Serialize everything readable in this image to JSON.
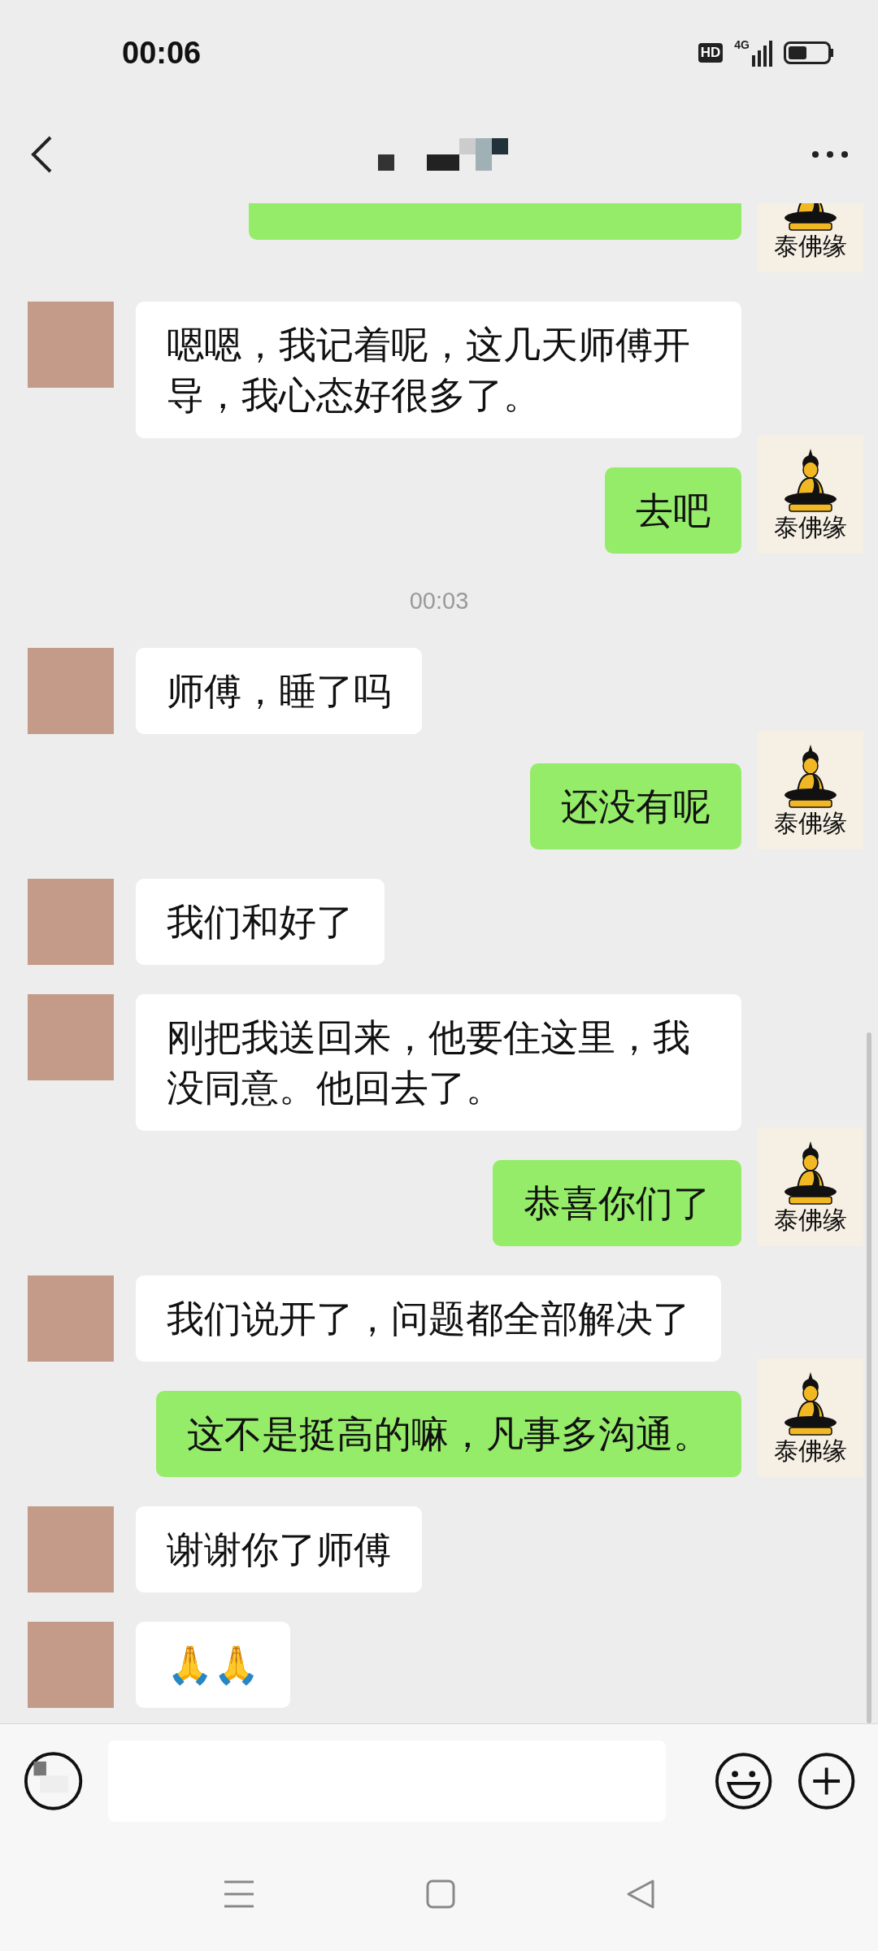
{
  "status_bar": {
    "time": "00:06",
    "hd_badge": "HD",
    "network": "4G"
  },
  "messages": [
    {
      "kind": "outgoing_cut",
      "avatar_label": "泰佛缘"
    },
    {
      "kind": "incoming",
      "text": "嗯嗯，我记着呢，这几天师傅开导，我心态好很多了。"
    },
    {
      "kind": "outgoing",
      "text": "去吧",
      "avatar_label": "泰佛缘"
    },
    {
      "kind": "time",
      "text": "00:03"
    },
    {
      "kind": "incoming",
      "text": "师傅，睡了吗"
    },
    {
      "kind": "outgoing",
      "text": "还没有呢",
      "avatar_label": "泰佛缘"
    },
    {
      "kind": "incoming",
      "text": "我们和好了"
    },
    {
      "kind": "incoming",
      "text": "刚把我送回来，他要住这里，我没同意。他回去了。"
    },
    {
      "kind": "outgoing",
      "text": "恭喜你们了",
      "avatar_label": "泰佛缘"
    },
    {
      "kind": "incoming",
      "text": "我们说开了，问题都全部解决了"
    },
    {
      "kind": "outgoing",
      "text": "这不是挺高的嘛，凡事多沟通。",
      "avatar_label": "泰佛缘"
    },
    {
      "kind": "incoming",
      "text": "谢谢你了师傅"
    },
    {
      "kind": "incoming",
      "text": "🙏🙏"
    }
  ]
}
